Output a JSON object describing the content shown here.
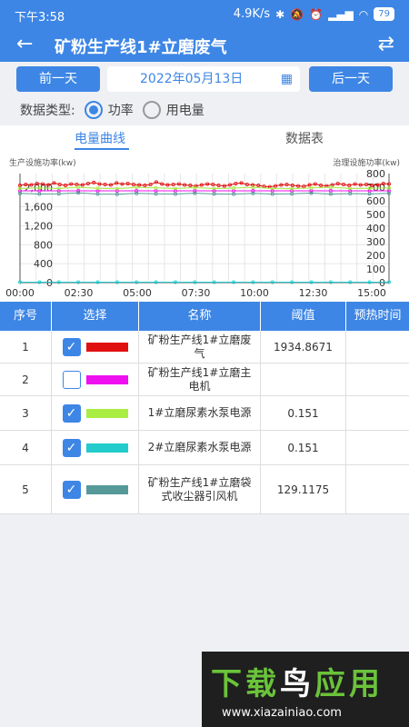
{
  "status": {
    "time": "下午3:58",
    "speed": "4.9K/s",
    "battery": "79"
  },
  "header": {
    "title": "矿粉生产线1#立磨废气"
  },
  "controls": {
    "prev": "前一天",
    "date": "2022年05月13日",
    "next": "后一天"
  },
  "data_type": {
    "label": "数据类型:",
    "opt1": "功率",
    "opt2": "用电量"
  },
  "tabs": {
    "curve": "电量曲线",
    "table": "数据表"
  },
  "chart_data": {
    "type": "line",
    "ylabel_left": "生产设施功率(kw)",
    "ylabel_right": "治理设施功率(kw)",
    "x_ticks": [
      "00:00",
      "02:30",
      "05:00",
      "07:30",
      "10:00",
      "12:30",
      "15:00"
    ],
    "y_left_ticks": [
      "0",
      "400",
      "800",
      "1,200",
      "1,600",
      "2,000"
    ],
    "y_right_ticks": [
      "0",
      "100",
      "200",
      "300",
      "400",
      "500",
      "600",
      "700",
      "800"
    ],
    "ylim_left": [
      0,
      2300
    ],
    "ylim_right": [
      0,
      800
    ],
    "series": [
      {
        "color": "#e01010",
        "axis": "left",
        "values": [
          2050,
          2070,
          2060,
          2090,
          2080,
          2060,
          2100,
          2070,
          2050,
          2080,
          2070,
          2060,
          2090,
          2110,
          2080,
          2070,
          2060,
          2100,
          2080,
          2090,
          2070,
          2060,
          2050,
          2070,
          2120,
          2080,
          2060,
          2070,
          2080,
          2060,
          2050,
          2040,
          2060,
          2080,
          2070,
          2050,
          2040,
          2060,
          2090,
          2100,
          2070,
          2060,
          2050,
          2030,
          2020,
          2040,
          2060,
          2070,
          2050,
          2040,
          2030,
          2060,
          2080,
          2050,
          2040,
          2060,
          2090,
          2070,
          2050,
          2080,
          2060,
          2070,
          2050,
          2060,
          2090,
          2080
        ]
      },
      {
        "color": "#ee10ee",
        "axis": "left",
        "values": [
          1935,
          1935,
          1935,
          1935,
          1935,
          1935,
          1935,
          1935,
          1935,
          1935,
          1935,
          1935,
          1935,
          1935,
          1935,
          1935,
          1935,
          1935,
          1935,
          1935
        ]
      },
      {
        "color": "#aaee44",
        "axis": "right",
        "values": [
          690,
          695,
          690,
          700,
          692,
          688,
          700,
          695,
          690,
          697,
          690,
          693,
          700,
          690,
          688,
          695,
          700,
          690,
          692,
          695
        ]
      },
      {
        "color": "#22cccc",
        "axis": "right",
        "values": [
          3,
          3,
          3,
          3,
          3,
          3,
          3,
          3,
          3,
          3,
          3,
          3,
          3,
          3,
          3,
          3,
          3,
          3,
          3,
          3
        ]
      },
      {
        "color": "#559999",
        "axis": "right",
        "values": [
          655,
          650,
          652,
          658,
          650,
          648,
          655,
          652,
          650,
          656,
          651,
          649,
          655,
          650,
          652,
          657,
          650,
          653,
          651,
          655
        ]
      }
    ]
  },
  "table": {
    "headers": [
      "序号",
      "选择",
      "名称",
      "阈值",
      "预热时间"
    ],
    "rows": [
      {
        "no": "1",
        "checked": true,
        "color": "#e01010",
        "name": "矿粉生产线1#立磨废气",
        "threshold": "1934.8671"
      },
      {
        "no": "2",
        "checked": false,
        "color": "#ee10ee",
        "name": "矿粉生产线1#立磨主电机",
        "threshold": ""
      },
      {
        "no": "3",
        "checked": true,
        "color": "#aaee44",
        "name": "1#立磨尿素水泵电源",
        "threshold": "0.151"
      },
      {
        "no": "4",
        "checked": true,
        "color": "#22cccc",
        "name": "2#立磨尿素水泵电源",
        "threshold": "0.151"
      },
      {
        "no": "5",
        "checked": true,
        "color": "#559999",
        "name": "矿粉生产线1#立磨袋式收尘器引风机",
        "threshold": "129.1175"
      }
    ]
  },
  "watermark": {
    "top_g": "下载",
    "top_w": "鸟",
    "top_g2": "应用",
    "url": "www.xiazainiao.com"
  }
}
